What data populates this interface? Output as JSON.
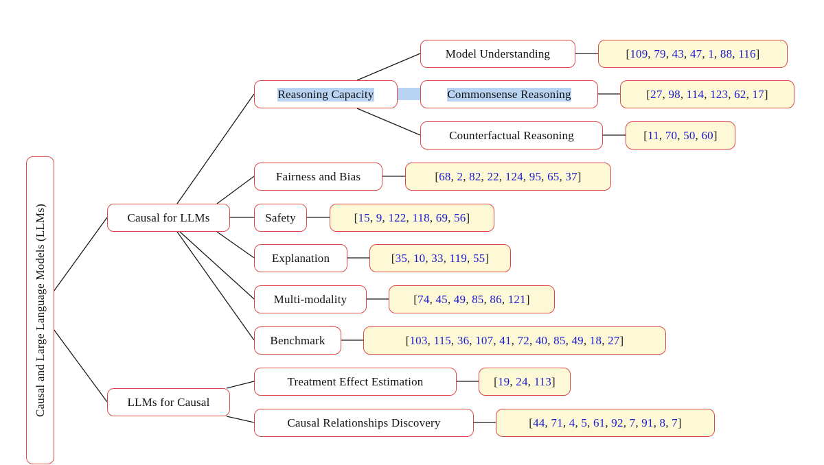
{
  "diagram": {
    "root": {
      "label": "Causal and Large Language Models (LLMs)"
    },
    "branches": [
      {
        "label": "Causal for LLMs",
        "children": [
          {
            "label": "Reasoning Capacity",
            "highlighted": true,
            "children": [
              {
                "label": "Model Understanding",
                "refs": [
                  109,
                  79,
                  43,
                  47,
                  1,
                  88,
                  116
                ]
              },
              {
                "label": "Commonsense Reasoning",
                "highlighted": true,
                "refs": [
                  27,
                  98,
                  114,
                  123,
                  62,
                  17
                ]
              },
              {
                "label": "Counterfactual Reasoning",
                "refs": [
                  11,
                  70,
                  50,
                  60
                ]
              }
            ]
          },
          {
            "label": "Fairness and Bias",
            "refs": [
              68,
              2,
              82,
              22,
              124,
              95,
              65,
              37
            ]
          },
          {
            "label": "Safety",
            "refs": [
              15,
              9,
              122,
              118,
              69,
              56
            ]
          },
          {
            "label": "Explanation",
            "refs": [
              35,
              10,
              33,
              119,
              55
            ]
          },
          {
            "label": "Multi-modality",
            "refs": [
              74,
              45,
              49,
              85,
              86,
              121
            ]
          },
          {
            "label": "Benchmark",
            "refs": [
              103,
              115,
              36,
              107,
              41,
              72,
              40,
              85,
              49,
              18,
              27
            ]
          }
        ]
      },
      {
        "label": "LLMs for Causal",
        "children": [
          {
            "label": "Treatment Effect Estimation",
            "refs": [
              19,
              24,
              113
            ]
          },
          {
            "label": "Causal Relationships Discovery",
            "refs": [
              44,
              71,
              4,
              5,
              61,
              92,
              7,
              91,
              8,
              7
            ]
          }
        ]
      }
    ]
  },
  "colors": {
    "node_border": "#e04848",
    "ref_fill": "#fdf8d6",
    "ref_number": "#1a1acc",
    "highlight": "#b9d4f3",
    "edge": "#1a1a1a"
  }
}
